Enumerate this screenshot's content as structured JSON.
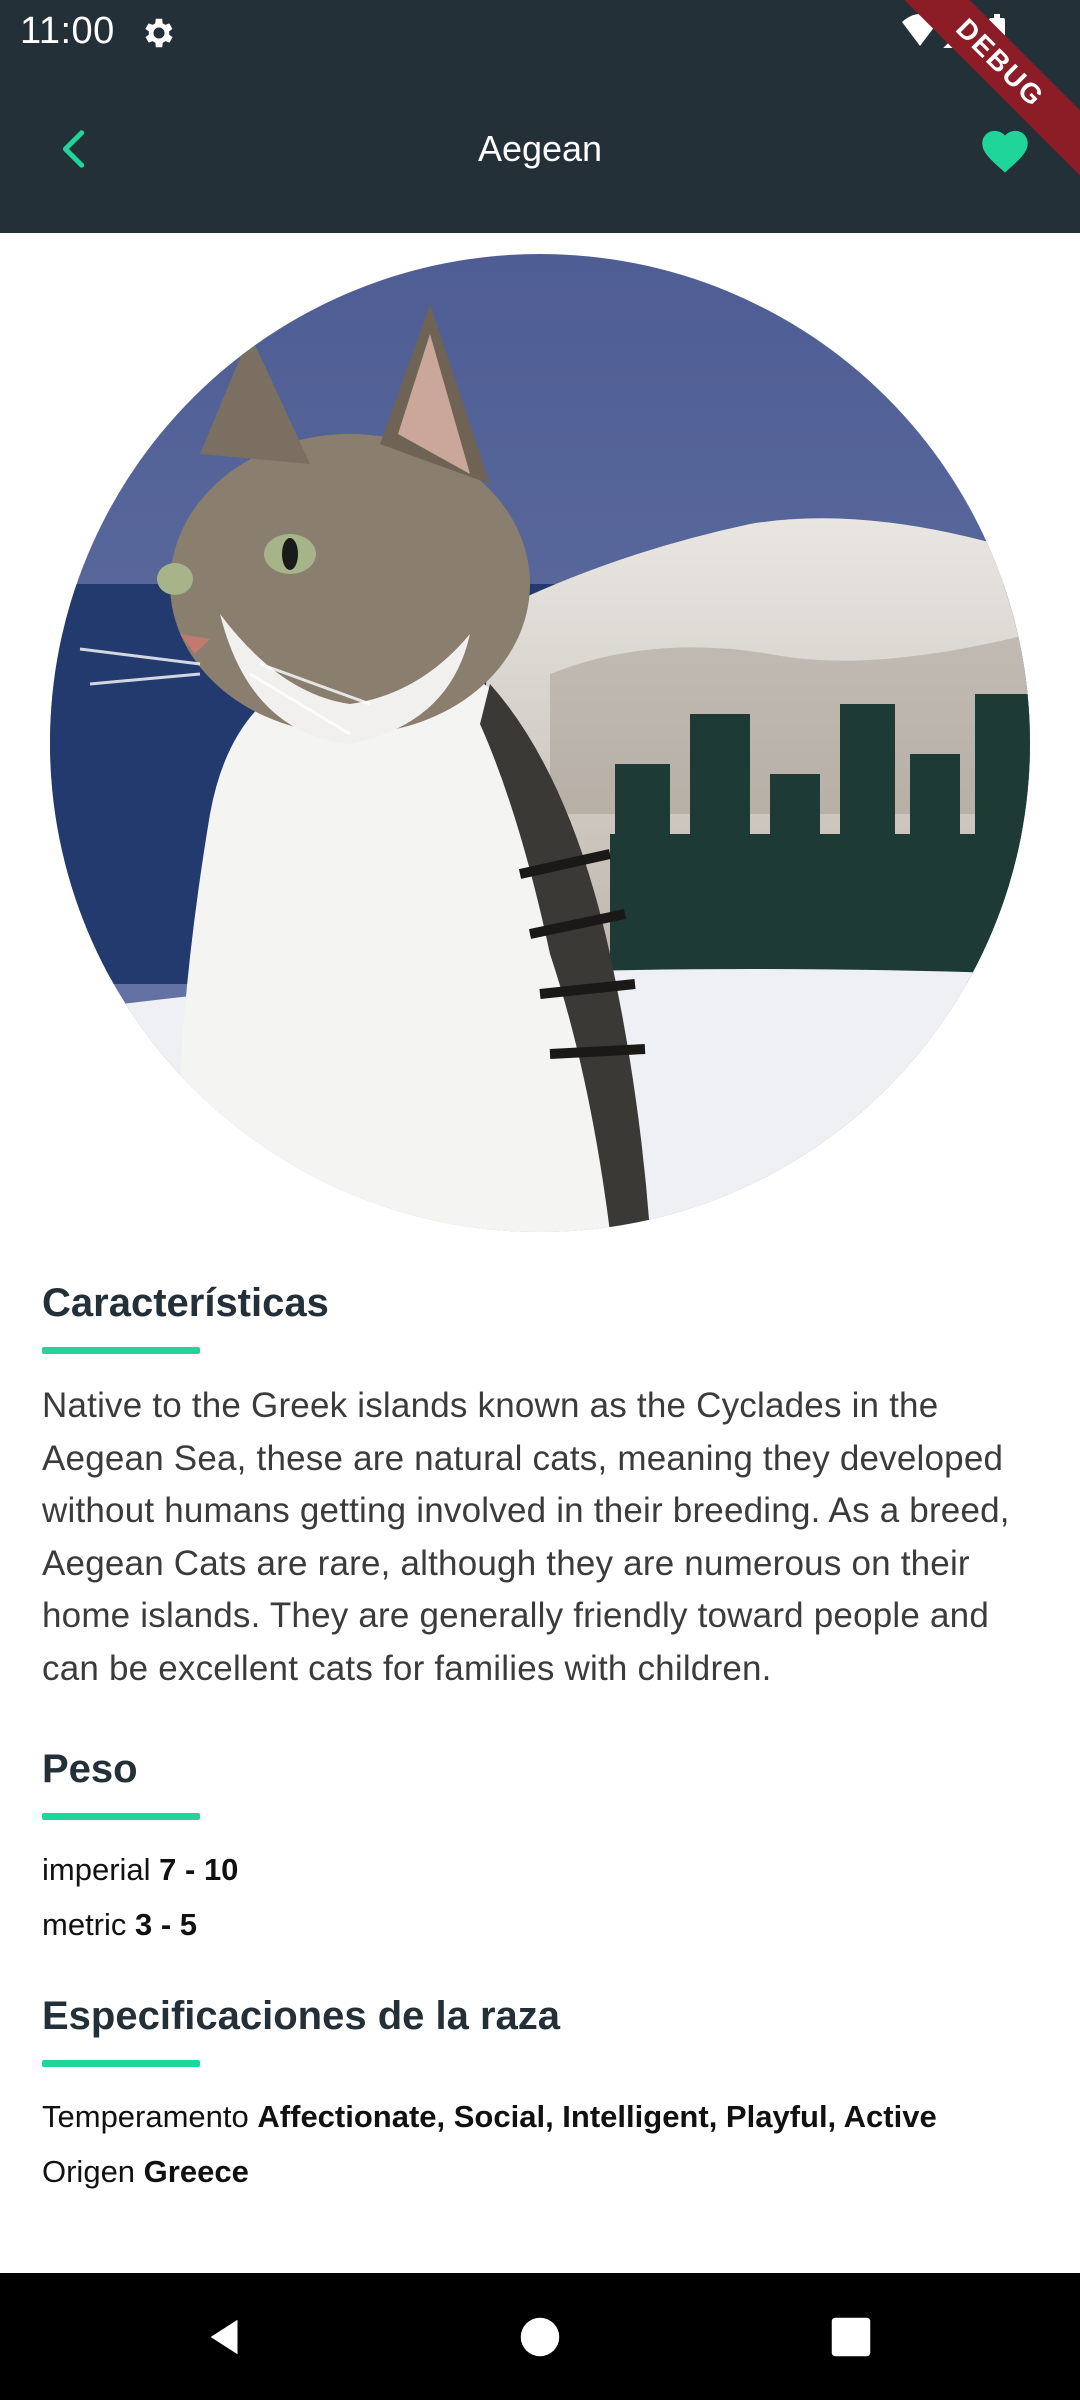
{
  "status_bar": {
    "time": "11:00",
    "icons": [
      "gear-icon",
      "wifi-icon",
      "signal-icon",
      "battery-icon"
    ]
  },
  "debug_banner": "DEBUG",
  "app_bar": {
    "title": "Aegean",
    "back_icon": "chevron-left-icon",
    "favorite_icon": "heart-icon",
    "favorite_active": true
  },
  "colors": {
    "app_bar_bg": "#243038",
    "accent": "#1fd59a",
    "heading": "#243038",
    "ribbon": "#8c1c26"
  },
  "cat_image": {
    "subject": "cat photo"
  },
  "sections": {
    "characteristics": {
      "title": "Características",
      "description": "Native to the Greek islands known as the Cyclades in the Aegean Sea, these are natural cats, meaning they developed without humans getting involved in their breeding. As a breed, Aegean Cats are rare, although they are numerous on their home islands. They are generally friendly toward people and can be excellent cats for families with children."
    },
    "weight": {
      "title": "Peso",
      "imperial_label": "imperial",
      "imperial_value": "7 - 10",
      "metric_label": "metric",
      "metric_value": "3 - 5"
    },
    "breed_specs": {
      "title": "Especificaciones de la raza",
      "temperament_label": "Temperamento",
      "temperament_value": "Affectionate, Social, Intelligent, Playful, Active",
      "origin_label": "Origen",
      "origin_value": "Greece"
    }
  },
  "nav_bar": {
    "back_icon": "nav-back-icon",
    "home_icon": "nav-home-icon",
    "recents_icon": "nav-recents-icon"
  }
}
